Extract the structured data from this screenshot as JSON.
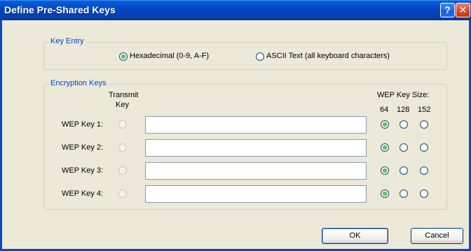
{
  "window": {
    "title": "Define Pre-Shared Keys",
    "help_glyph": "?",
    "close_glyph": "✕"
  },
  "key_entry": {
    "legend": "Key Entry",
    "options": [
      {
        "label": "Hexadecimal (0-9, A-F)",
        "selected": true
      },
      {
        "label": "ASCII Text (all keyboard characters)",
        "selected": false
      }
    ]
  },
  "encryption_keys": {
    "legend": "Encryption Keys",
    "transmit_key_header": [
      "Transmit",
      "Key"
    ],
    "wep_size_header": "WEP Key Size:",
    "sizes": [
      "64",
      "128",
      "152"
    ],
    "keys": [
      {
        "label": "WEP Key 1:",
        "value": "",
        "size_selected": "64"
      },
      {
        "label": "WEP Key 2:",
        "value": "",
        "size_selected": "64"
      },
      {
        "label": "WEP Key 3:",
        "value": "",
        "size_selected": "64"
      },
      {
        "label": "WEP Key 4:",
        "value": "",
        "size_selected": "64"
      }
    ]
  },
  "buttons": {
    "ok": "OK",
    "cancel": "Cancel"
  }
}
